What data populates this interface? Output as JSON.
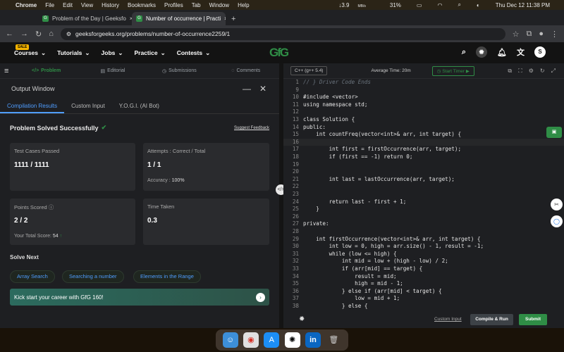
{
  "menubar": {
    "apple": "",
    "app": "Chrome",
    "items": [
      "File",
      "Edit",
      "View",
      "History",
      "Bookmarks",
      "Profiles",
      "Tab",
      "Window",
      "Help"
    ],
    "network": "↓3.9",
    "network_unit": "MB/s",
    "battery": "31%",
    "datetime": "Thu Dec 12  11:38 PM"
  },
  "tabs": [
    {
      "title": "Problem of the Day | Geeksfo",
      "close": "×"
    },
    {
      "title": "Number of occurrence | Practi",
      "close": "×"
    }
  ],
  "new_tab": "+",
  "address": {
    "url": "geeksforgeeks.org/problems/number-of-occurrence2259/1"
  },
  "gfgnav": {
    "sale_badge": "SALE",
    "items": [
      "Courses",
      "Tutorials",
      "Jobs",
      "Practice",
      "Contests"
    ],
    "logo": "GfG",
    "avatar_letter": "S"
  },
  "problem_tabs": [
    "Problem",
    "Editorial",
    "Submissions",
    "Comments"
  ],
  "output": {
    "title": "Output Window",
    "result_tabs": [
      "Compilation Results",
      "Custom Input",
      "Y.O.G.I. (AI Bot)"
    ],
    "status": "Problem Solved Successfully",
    "feedback": "Suggest Feedback",
    "cards": {
      "test_cases_label": "Test Cases Passed",
      "test_cases_value": "1111 / 1111",
      "attempts_label": "Attempts : Correct / Total",
      "attempts_value": "1 / 1",
      "accuracy_label": "Accuracy :",
      "accuracy_value": "100%",
      "points_label": "Points Scored",
      "points_value": "2 / 2",
      "total_score_label": "Your Total Score:",
      "total_score_value": "54",
      "time_label": "Time Taken",
      "time_value": "0.3"
    },
    "solve_next_title": "Solve Next",
    "solve_next": [
      "Array Search",
      "Searching a number",
      "Elements in the Range"
    ],
    "banner": "Kick start your career with GfG 160!"
  },
  "editor": {
    "language": "C++ (g++ 5.4)",
    "avg_time": "Average Time: 20m",
    "timer": "Start Timer",
    "lines": [
      {
        "n": "1",
        "t": "// } Driver Code Ends"
      },
      {
        "n": "9",
        "t": ""
      },
      {
        "n": "10",
        "t": "#include <vector>"
      },
      {
        "n": "11",
        "t": "using namespace std;"
      },
      {
        "n": "12",
        "t": ""
      },
      {
        "n": "13",
        "t": "class Solution {"
      },
      {
        "n": "14",
        "t": "public:"
      },
      {
        "n": "15",
        "t": "    int countFreq(vector<int>& arr, int target) {"
      },
      {
        "n": "16",
        "t": ""
      },
      {
        "n": "17",
        "t": "        int first = firstOccurrence(arr, target);"
      },
      {
        "n": "18",
        "t": "        if (first == -1) return 0;"
      },
      {
        "n": "19",
        "t": ""
      },
      {
        "n": "20",
        "t": ""
      },
      {
        "n": "21",
        "t": "        int last = lastOccurrence(arr, target);"
      },
      {
        "n": "22",
        "t": ""
      },
      {
        "n": "23",
        "t": ""
      },
      {
        "n": "24",
        "t": "        return last - first + 1;"
      },
      {
        "n": "25",
        "t": "    }"
      },
      {
        "n": "26",
        "t": ""
      },
      {
        "n": "27",
        "t": "private:"
      },
      {
        "n": "28",
        "t": ""
      },
      {
        "n": "29",
        "t": "    int firstOccurrence(vector<int>& arr, int target) {"
      },
      {
        "n": "30",
        "t": "        int low = 0, high = arr.size() - 1, result = -1;"
      },
      {
        "n": "31",
        "t": "        while (low <= high) {"
      },
      {
        "n": "32",
        "t": "            int mid = low + (high - low) / 2;"
      },
      {
        "n": "33",
        "t": "            if (arr[mid] == target) {"
      },
      {
        "n": "34",
        "t": "                result = mid;"
      },
      {
        "n": "35",
        "t": "                high = mid - 1;"
      },
      {
        "n": "36",
        "t": "            } else if (arr[mid] < target) {"
      },
      {
        "n": "37",
        "t": "                low = mid + 1;"
      },
      {
        "n": "38",
        "t": "            } else {"
      }
    ],
    "custom_input": "Custom Input",
    "run": "Compile & Run",
    "submit": "Submit"
  },
  "colors": {
    "accent_green": "#2f8d46",
    "link_blue": "#4f9dff"
  }
}
